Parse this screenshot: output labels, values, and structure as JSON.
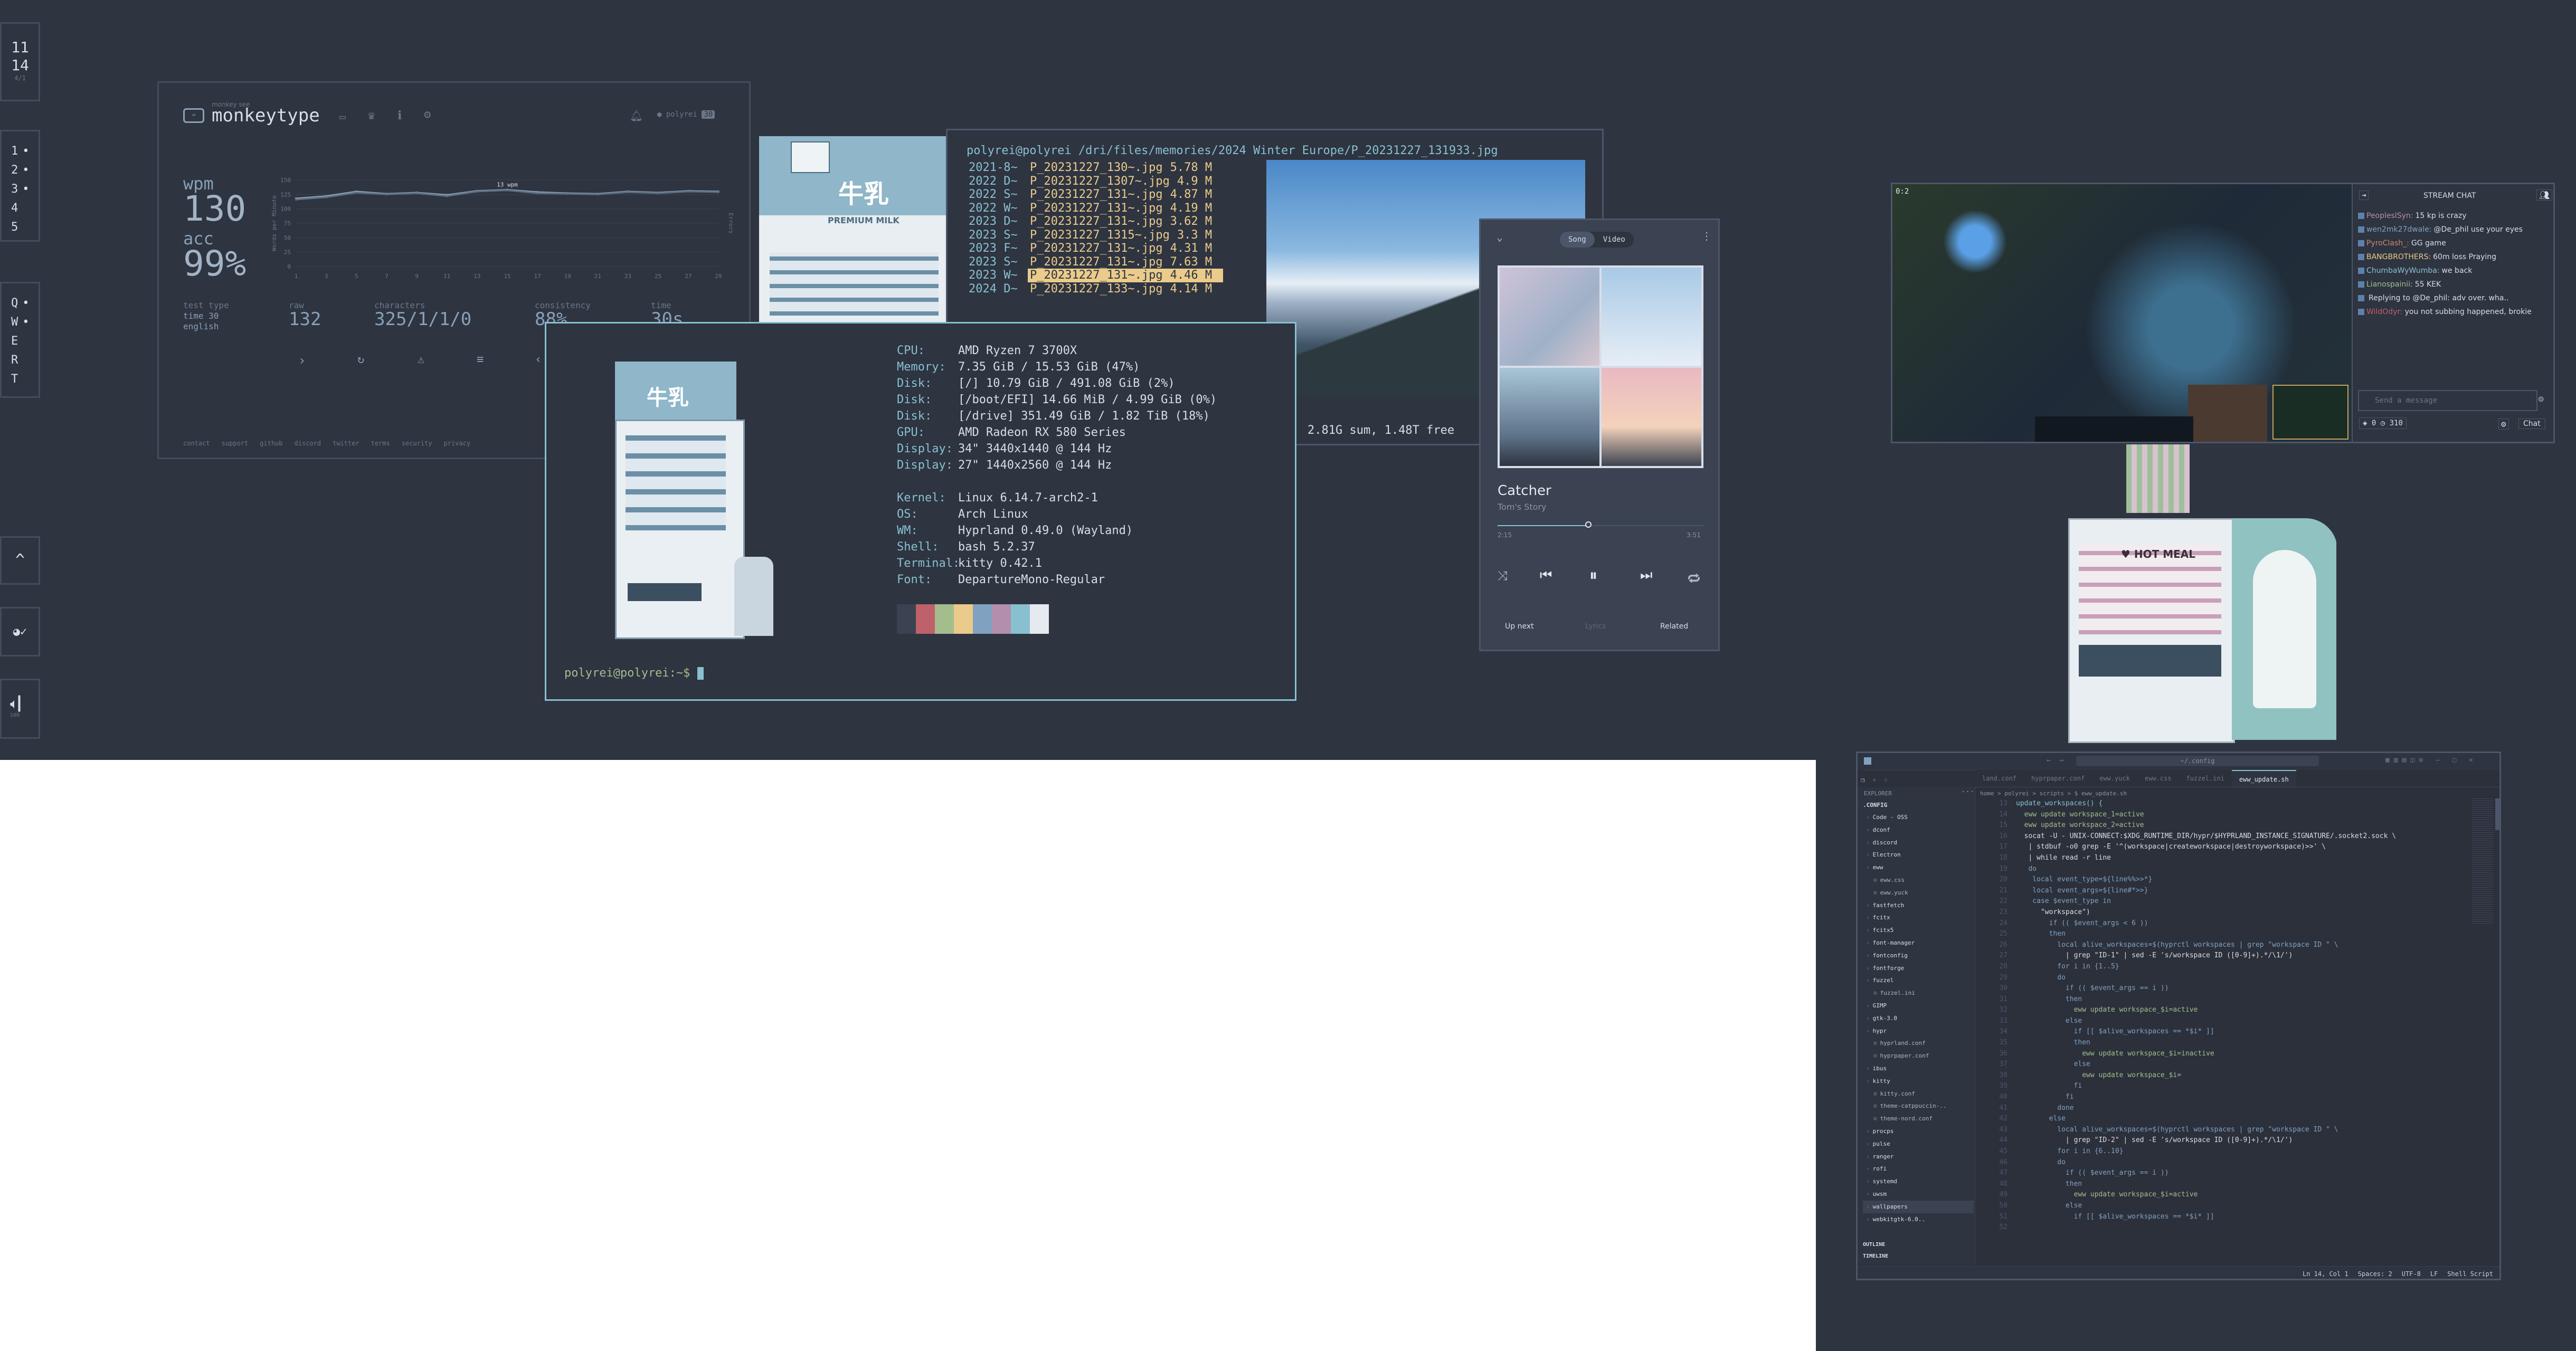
{
  "colors": {
    "bg": "#2e3440",
    "panel": "#3b4252",
    "border": "#4c566a",
    "accent": "#88c0d0",
    "highlight": "#ebcb8b",
    "green": "#a3be8c"
  },
  "bar": {
    "clock_h": "11",
    "clock_m": "14",
    "clock_d": "4/1",
    "workspaces": [
      "1",
      "2",
      "3",
      "4",
      "5"
    ],
    "workspace_marks": [
      "•",
      "•",
      "•",
      "",
      ""
    ],
    "qwert": [
      "Q",
      "W",
      "E",
      "R",
      "T"
    ],
    "qwert_marks": [
      "•",
      "•",
      "",
      "",
      ""
    ],
    "tray_up": "^",
    "network_icon": "wifi-icon",
    "volume_label": "100"
  },
  "monkeytype": {
    "brand_small": "monkey see",
    "brand": "monkeytype",
    "user": "polyrei",
    "user_badge": "30",
    "wpm_label": "wpm",
    "wpm": "130",
    "acc_label": "acc",
    "acc": "99%",
    "ylabel_left": "Words per Minute",
    "ylabel_right": "Errors",
    "y_ticks": [
      "150",
      "125",
      "100",
      "75",
      "50",
      "25",
      "0"
    ],
    "x_ticks": [
      "1",
      "3",
      "5",
      "7",
      "9",
      "11",
      "13",
      "15",
      "17",
      "19",
      "21",
      "23",
      "25",
      "27",
      "29"
    ],
    "tooltip": "13 wpm",
    "test_type_label": "test type",
    "test_type": "time 30",
    "test_lang": "english",
    "raw_label": "raw",
    "raw": "132",
    "characters_label": "characters",
    "characters": "325/1/1/0",
    "consistency_label": "consistency",
    "consistency": "88%",
    "time_label": "time",
    "time": "30s",
    "footer": [
      "contact",
      "support",
      "github",
      "discord",
      "twitter",
      "terms",
      "security",
      "privacy"
    ],
    "chart_data": {
      "type": "line",
      "x": [
        1,
        3,
        5,
        7,
        9,
        11,
        13,
        15,
        17,
        19,
        21,
        23,
        25,
        27,
        29
      ],
      "series": [
        {
          "values": [
            118,
            122,
            130,
            126,
            128,
            124,
            131,
            133,
            129,
            127,
            126,
            130,
            128,
            131,
            130
          ]
        },
        {
          "values": [
            116,
            120,
            128,
            125,
            127,
            122,
            130,
            132,
            127,
            126,
            125,
            129,
            127,
            130,
            129
          ]
        }
      ],
      "ylim": [
        0,
        150
      ]
    }
  },
  "lf": {
    "path": "polyrei@polyrei /dri/files/memories/2024 Winter Europe/P_20231227_131933.jpg",
    "rows": [
      {
        "left": "2021-8~",
        "name": "P_20231227_130~.jpg",
        "size": "5.78 M",
        "hl": false
      },
      {
        "left": "2022 D~",
        "name": "P_20231227_1307~.jpg",
        "size": "4.9 M",
        "hl": false
      },
      {
        "left": "2022 S~",
        "name": "P_20231227_131~.jpg",
        "size": "4.87 M",
        "hl": false
      },
      {
        "left": "2022 W~",
        "name": "P_20231227_131~.jpg",
        "size": "4.19 M",
        "hl": false
      },
      {
        "left": "2023 D~",
        "name": "P_20231227_131~.jpg",
        "size": "3.62 M",
        "hl": false
      },
      {
        "left": "2023 S~",
        "name": "P_20231227_1315~.jpg",
        "size": "3.3 M",
        "hl": false
      },
      {
        "left": "2023 F~",
        "name": "P_20231227_131~.jpg",
        "size": "4.31 M",
        "hl": false
      },
      {
        "left": "2023 S~",
        "name": "P_20231227_131~.jpg",
        "size": "7.63 M",
        "hl": false
      },
      {
        "left": "2023 W~",
        "name": "P_20231227_131~.jpg",
        "size": "4.46 M",
        "hl": true
      },
      {
        "left": "2024 D~",
        "name": "P_20231227_133~.jpg",
        "size": "4.14 M",
        "hl": false
      }
    ],
    "status": "2.81G sum, 1.48T free"
  },
  "fetch": {
    "labels": [
      "CPU:",
      "Memory:",
      "Disk:",
      "Disk:",
      "Disk:",
      "GPU:",
      "Display:",
      "Display:",
      "",
      "Kernel:",
      "OS:",
      "WM:",
      "Shell:",
      "Terminal:",
      "Font:"
    ],
    "values": [
      "AMD Ryzen 7 3700X",
      "7.35 GiB / 15.53 GiB (47%)",
      "[/] 10.79 GiB / 491.08 GiB (2%)",
      "[/boot/EFI] 14.66 MiB / 4.99 GiB (0%)",
      "[/drive] 351.49 GiB / 1.82 TiB (18%)",
      "AMD Radeon RX 580 Series",
      "34\" 3440x1440 @ 144 Hz",
      "27\" 1440x2560 @ 144 Hz",
      "",
      "Linux 6.14.7-arch2-1",
      "Arch Linux",
      "Hyprland 0.49.0 (Wayland)",
      "bash 5.2.37",
      "kitty 0.42.1",
      "DepartureMono-Regular"
    ],
    "palette": [
      "#3b4252",
      "#bf616a",
      "#a3be8c",
      "#ebcb8b",
      "#81a1c1",
      "#b48ead",
      "#88c0d0",
      "#e5e9f0"
    ],
    "prompt": "polyrei@polyrei:~$",
    "milk_top": "牛乳",
    "milk_sub": "PREMIUM MILK"
  },
  "player": {
    "tabs": [
      "Song",
      "Video"
    ],
    "title": "Catcher",
    "artist": "Tom's Story",
    "t_start": "2:15",
    "t_end": "3:51",
    "progress": 0.44,
    "bottom_tabs": [
      "Up next",
      "Lyrics",
      "Related"
    ]
  },
  "twitch": {
    "top_badge": "0:2",
    "chat_title": "STREAM CHAT",
    "messages": [
      {
        "user": "PeopleslSyn:",
        "text": "15 kp is crazy",
        "color": "#b48ead"
      },
      {
        "user": "wen2mk27dwale:",
        "text": "@De_phil use your eyes",
        "color": "#81a1c1"
      },
      {
        "user": "PyroClash_:",
        "text": "GG game",
        "color": "#d08770"
      },
      {
        "user": "BANGBROTHERS:",
        "text": "60m loss Praying",
        "color": "#ebcb8b"
      },
      {
        "user": "ChumbaWyWumba:",
        "text": "we back",
        "color": "#88c0d0"
      },
      {
        "user": "Lianospainii:",
        "text": "55 KEK",
        "color": "#a3be8c"
      },
      {
        "user": "",
        "text": "Replying to @De_phil: adv over. wha..",
        "color": "#d8dee9"
      },
      {
        "user": "WildOdyr:",
        "text": "you not subbing happened, brokie",
        "color": "#bf616a"
      }
    ],
    "input_placeholder": "Send a message",
    "points": "0",
    "bits": "310",
    "chat_button": "Chat"
  },
  "vscode": {
    "search": "~/.config",
    "tabs": [
      "land.conf",
      "hyprpaper.conf",
      "eww.yuck",
      "eww.css",
      "fuzzel.ini",
      "eww_update.sh"
    ],
    "explorer_title": "EXPLORER",
    "tree_root": ".CONFIG",
    "tree": [
      "Code - OSS",
      "dconf",
      "discord",
      "Electron",
      "eww",
      "eww.css",
      "eww.yuck",
      "fastfetch",
      "fcitx",
      "fcitx5",
      "font-manager",
      "fontconfig",
      "fontforge",
      "fuzzel",
      "fuzzel.ini",
      "GIMP",
      "gtk-3.0",
      "hypr",
      "hyprland.conf",
      "hyprpaper.conf",
      "ibus",
      "kitty",
      "kitty.conf",
      "theme-catppuccin-..",
      "theme-nord.conf",
      "procps",
      "pulse",
      "ranger",
      "rofi",
      "systemd",
      "uwsm",
      "wallpapers",
      "webkitgtk-6.0.."
    ],
    "outline": "OUTLINE",
    "timeline": "TIMELINE",
    "breadcrumb": "home > polyrei > scripts > $ eww_update.sh",
    "line_start": 13,
    "code": [
      "",
      "update_workspaces() {",
      "  eww update workspace_1=active",
      "  eww update workspace_2=active",
      "  socat -U - UNIX-CONNECT:$XDG_RUNTIME_DIR/hypr/$HYPRLAND_INSTANCE_SIGNATURE/.socket2.sock \\",
      "   | stdbuf -o0 grep -E '^(workspace|createworkspace|destroyworkspace)>>' \\",
      "   | while read -r line",
      "   do",
      "    local event_type=${line%%>>*}",
      "    local event_args=${line#*>>}",
      "    case $event_type in",
      "      \"workspace\")",
      "        if (( $event_args < 6 ))",
      "        then",
      "          local alive_workspaces=$(hyprctl workspaces | grep \"workspace ID \" \\",
      "            | grep \"ID-1\" | sed -E 's/workspace ID ([0-9]+).*/\\1/')",
      "          for i in {1..5}",
      "          do",
      "            if (( $event_args == i ))",
      "            then",
      "              eww update workspace_$i=active",
      "            else",
      "              if [[ $alive_workspaces == *$i* ]]",
      "              then",
      "                eww update workspace_$i=inactive",
      "              else",
      "                eww update workspace_$i=",
      "              fi",
      "            fi",
      "          done",
      "        else",
      "          local alive_workspaces=$(hyprctl workspaces | grep \"workspace ID \" \\",
      "            | grep \"ID-2\" | sed -E 's/workspace ID ([0-9]+).*/\\1/')",
      "          for i in {6..10}",
      "          do",
      "            if (( $event_args == i ))",
      "            then",
      "              eww update workspace_$i=active",
      "            else",
      "              if [[ $alive_workspaces == *$i* ]]"
    ],
    "status": [
      "Ln 14, Col 1",
      "Spaces: 2",
      "UTF-8",
      "LF",
      "Shell Script"
    ]
  }
}
